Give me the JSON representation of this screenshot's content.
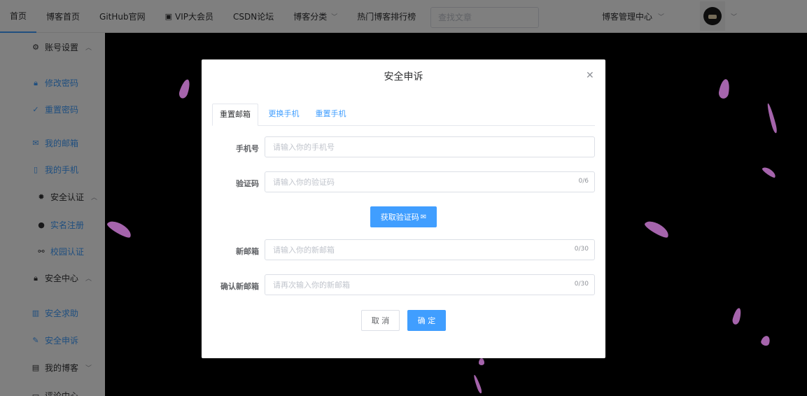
{
  "nav": {
    "items": [
      "首页",
      "博客首页",
      "GitHub官网",
      "VIP大会员",
      "CSDN论坛",
      "博客分类",
      "热门博客排行榜"
    ],
    "search_placeholder": "查找文章",
    "manage": "博客管理中心"
  },
  "sidebar": {
    "account": "账号设置",
    "change_password": "修改密码",
    "reset_password": "重置密码",
    "my_email": "我的邮箱",
    "my_phone": "我的手机",
    "security_auth": "安全认证",
    "real_name": "实名注册",
    "campus": "校园认证",
    "security_center": "安全中心",
    "security_help": "安全求助",
    "security_appeal": "安全申诉",
    "my_blog": "我的博客",
    "cut_off": "评论中心"
  },
  "dialog": {
    "title": "安全申诉",
    "tabs": [
      "重置邮箱",
      "更换手机",
      "重置手机"
    ],
    "phone_label": "手机号",
    "phone_placeholder": "请输入你的手机号",
    "code_label": "验证码",
    "code_placeholder": "请输入你的验证码",
    "code_count": "0/6",
    "get_code": "获取验证码",
    "email_label": "新邮箱",
    "email_placeholder": "请输入你的新邮箱",
    "email_count": "0/30",
    "confirm_label": "确认新邮箱",
    "confirm_placeholder": "请再次输入你的新邮箱",
    "confirm_count": "0/30",
    "cancel": "取 消",
    "ok": "确 定"
  },
  "colors": {
    "primary": "#409eff",
    "petal": "#b76fbf"
  }
}
